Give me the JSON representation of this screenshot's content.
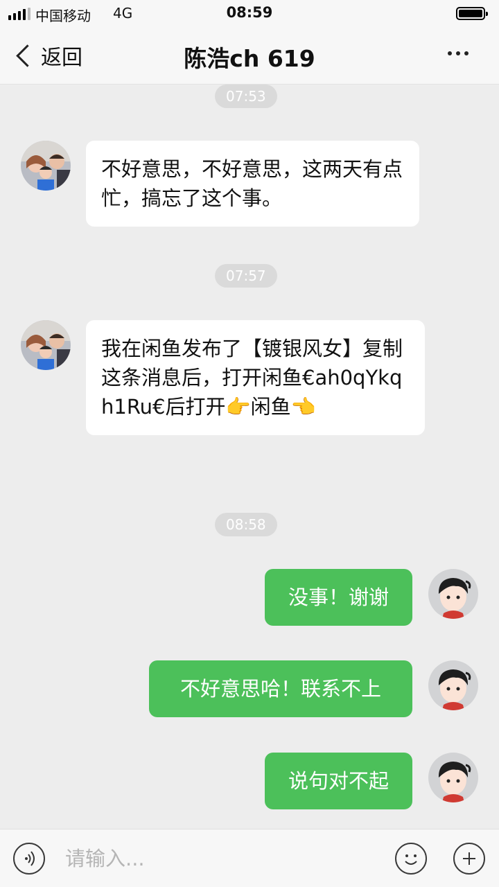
{
  "status_bar": {
    "carrier": "中国移动",
    "network": "4G",
    "time": "08:59"
  },
  "nav": {
    "back_label": "返回",
    "title": "陈浩ch 619"
  },
  "messages": [
    {
      "type": "time",
      "text": "07:53"
    },
    {
      "type": "in",
      "text": "不好意思，不好意思，这两天有点忙，搞忘了这个事。"
    },
    {
      "type": "time",
      "text": "07:57"
    },
    {
      "type": "in",
      "text": "我在闲鱼发布了【镀银风女】复制这条消息后，打开闲鱼€ah0qYkqh1Ru€后打开👉闲鱼👈"
    },
    {
      "type": "time",
      "text": "08:58"
    },
    {
      "type": "out",
      "text": "没事！谢谢"
    },
    {
      "type": "out",
      "text": "不好意思哈！联系不上"
    },
    {
      "type": "out",
      "text": "说句对不起"
    }
  ],
  "input": {
    "placeholder": "请输入..."
  },
  "colors": {
    "background": "#ededed",
    "outgoing_bubble": "#4cc05a",
    "incoming_bubble": "#ffffff",
    "time_pill": "#dadada"
  },
  "icons": {
    "voice": "voice-icon",
    "emoji": "emoji-icon",
    "add": "add-icon",
    "more": "more-icon",
    "back": "chevron-left-icon"
  }
}
